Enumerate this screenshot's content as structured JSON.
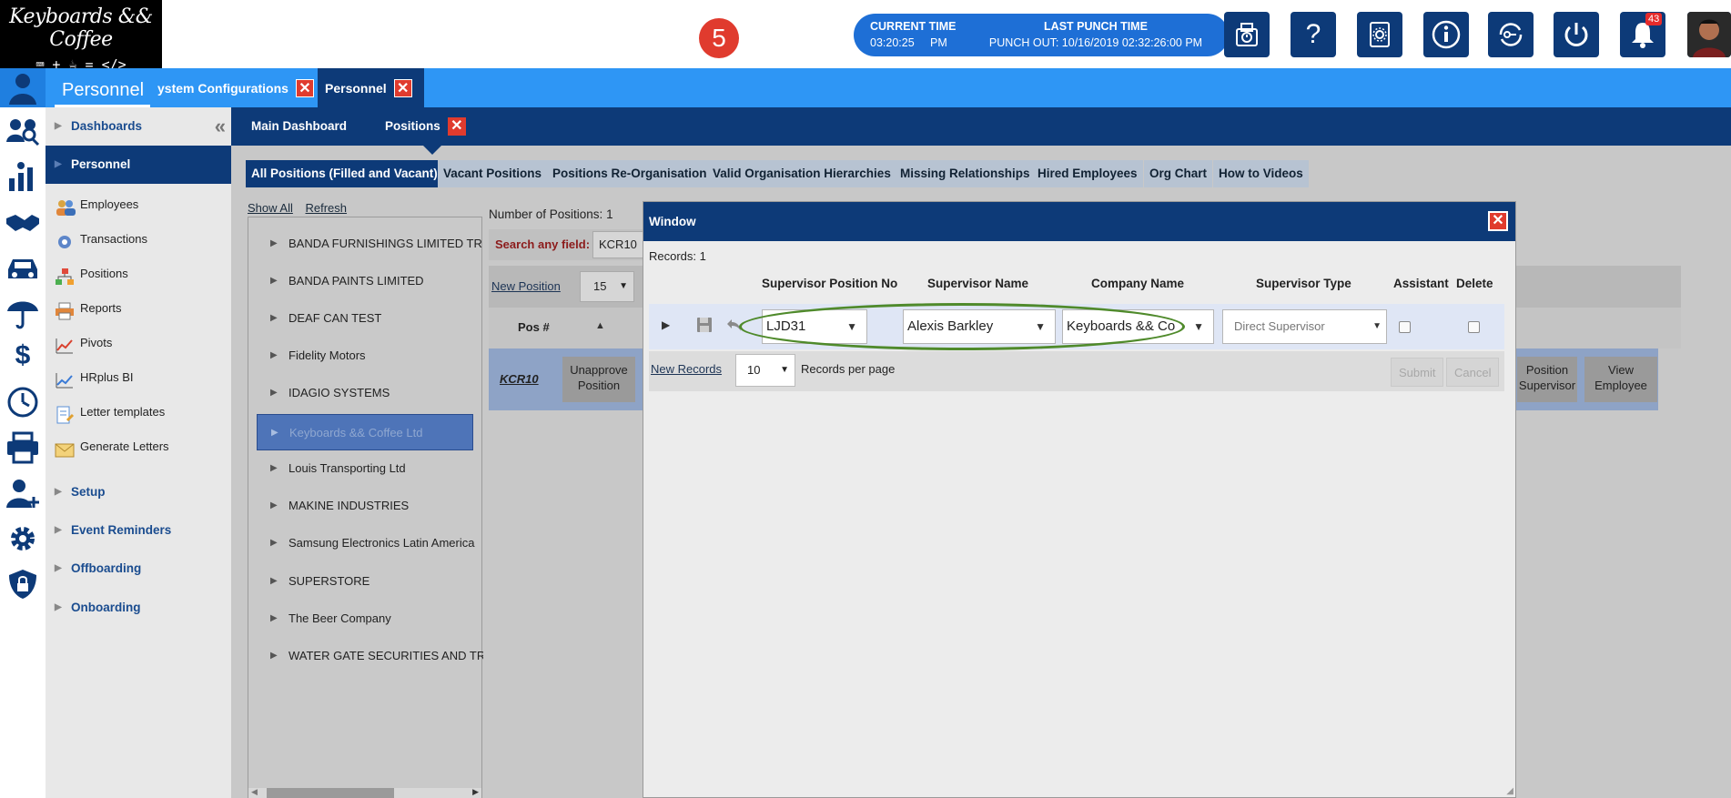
{
  "logo": {
    "line1": "Keyboards && Coffee",
    "line2": "⌨ + ☕ = </>"
  },
  "step_badge": "5",
  "time_panel": {
    "current_label": "CURRENT TIME",
    "current_value": "03:20:25     PM",
    "last_label": "LAST PUNCH TIME",
    "last_value": "PUNCH OUT: 10/16/2019 02:32:26:00 PM"
  },
  "toolbar_icons": [
    "punch-clock-icon",
    "help-icon",
    "settings-book-icon",
    "info-icon",
    "sync-key-icon",
    "power-icon",
    "bell-icon"
  ],
  "notification_count": "43",
  "module_title": "Personnel",
  "top_tabs": [
    {
      "label": "ystem Configurations"
    },
    {
      "label": "Personnel"
    }
  ],
  "sub_tabs": [
    {
      "label": "Main Dashboard"
    },
    {
      "label": "Positions"
    }
  ],
  "sidenav": {
    "dashboards": "Dashboards",
    "personnel": "Personnel",
    "items": [
      {
        "label": "Employees"
      },
      {
        "label": "Transactions"
      },
      {
        "label": "Positions"
      },
      {
        "label": "Reports"
      },
      {
        "label": "Pivots"
      },
      {
        "label": "HRplus BI"
      },
      {
        "label": "Letter templates"
      },
      {
        "label": "Generate Letters"
      }
    ],
    "setup": "Setup",
    "event_reminders": "Event Reminders",
    "offboarding": "Offboarding",
    "onboarding": "Onboarding"
  },
  "filter_chips": [
    "All Positions (Filled and Vacant)",
    "Vacant Positions",
    "Positions Re-Organisation",
    "Valid Organisation Hierarchies",
    "Missing Relationships",
    "Hired Employees",
    "Org Chart",
    "How to Videos"
  ],
  "tree": {
    "show_all": "Show All",
    "refresh": "Refresh",
    "companies": [
      "BANDA FURNISHINGS LIMITED TRI",
      "BANDA PAINTS LIMITED",
      "DEAF CAN TEST",
      "Fidelity Motors",
      "IDAGIO SYSTEMS",
      "Keyboards && Coffee Ltd",
      "Louis Transporting Ltd",
      "MAKINE INDUSTRIES",
      "Samsung Electronics Latin America",
      "SUPERSTORE",
      "The Beer Company",
      "WATER GATE SECURITIES AND TRUS"
    ]
  },
  "positions_grid": {
    "count_label": "Number of Positions:",
    "count": "1",
    "search_label": "Search any field:",
    "search_value": "KCR10",
    "new_position": "New Position",
    "page_size": "15",
    "pos_header": "Pos #",
    "row_pos": "KCR10",
    "unapprove": "Unapprove Position",
    "position_supervisor": "Position Supervisor",
    "view_employee": "View Employee"
  },
  "modal": {
    "title": "Window",
    "records_label": "Records:",
    "records_count": "1",
    "columns": [
      "Supervisor Position No",
      "Supervisor Name",
      "Company Name",
      "Supervisor Type",
      "Assistant",
      "Delete"
    ],
    "row": {
      "position_no": "LJD31",
      "name": "Alexis Barkley",
      "company": "Keyboards && Co",
      "type_placeholder": "Direct Supervisor"
    },
    "new_records": "New Records",
    "per_page_value": "10",
    "per_page_label": "Records per page",
    "submit": "Submit",
    "cancel": "Cancel"
  }
}
